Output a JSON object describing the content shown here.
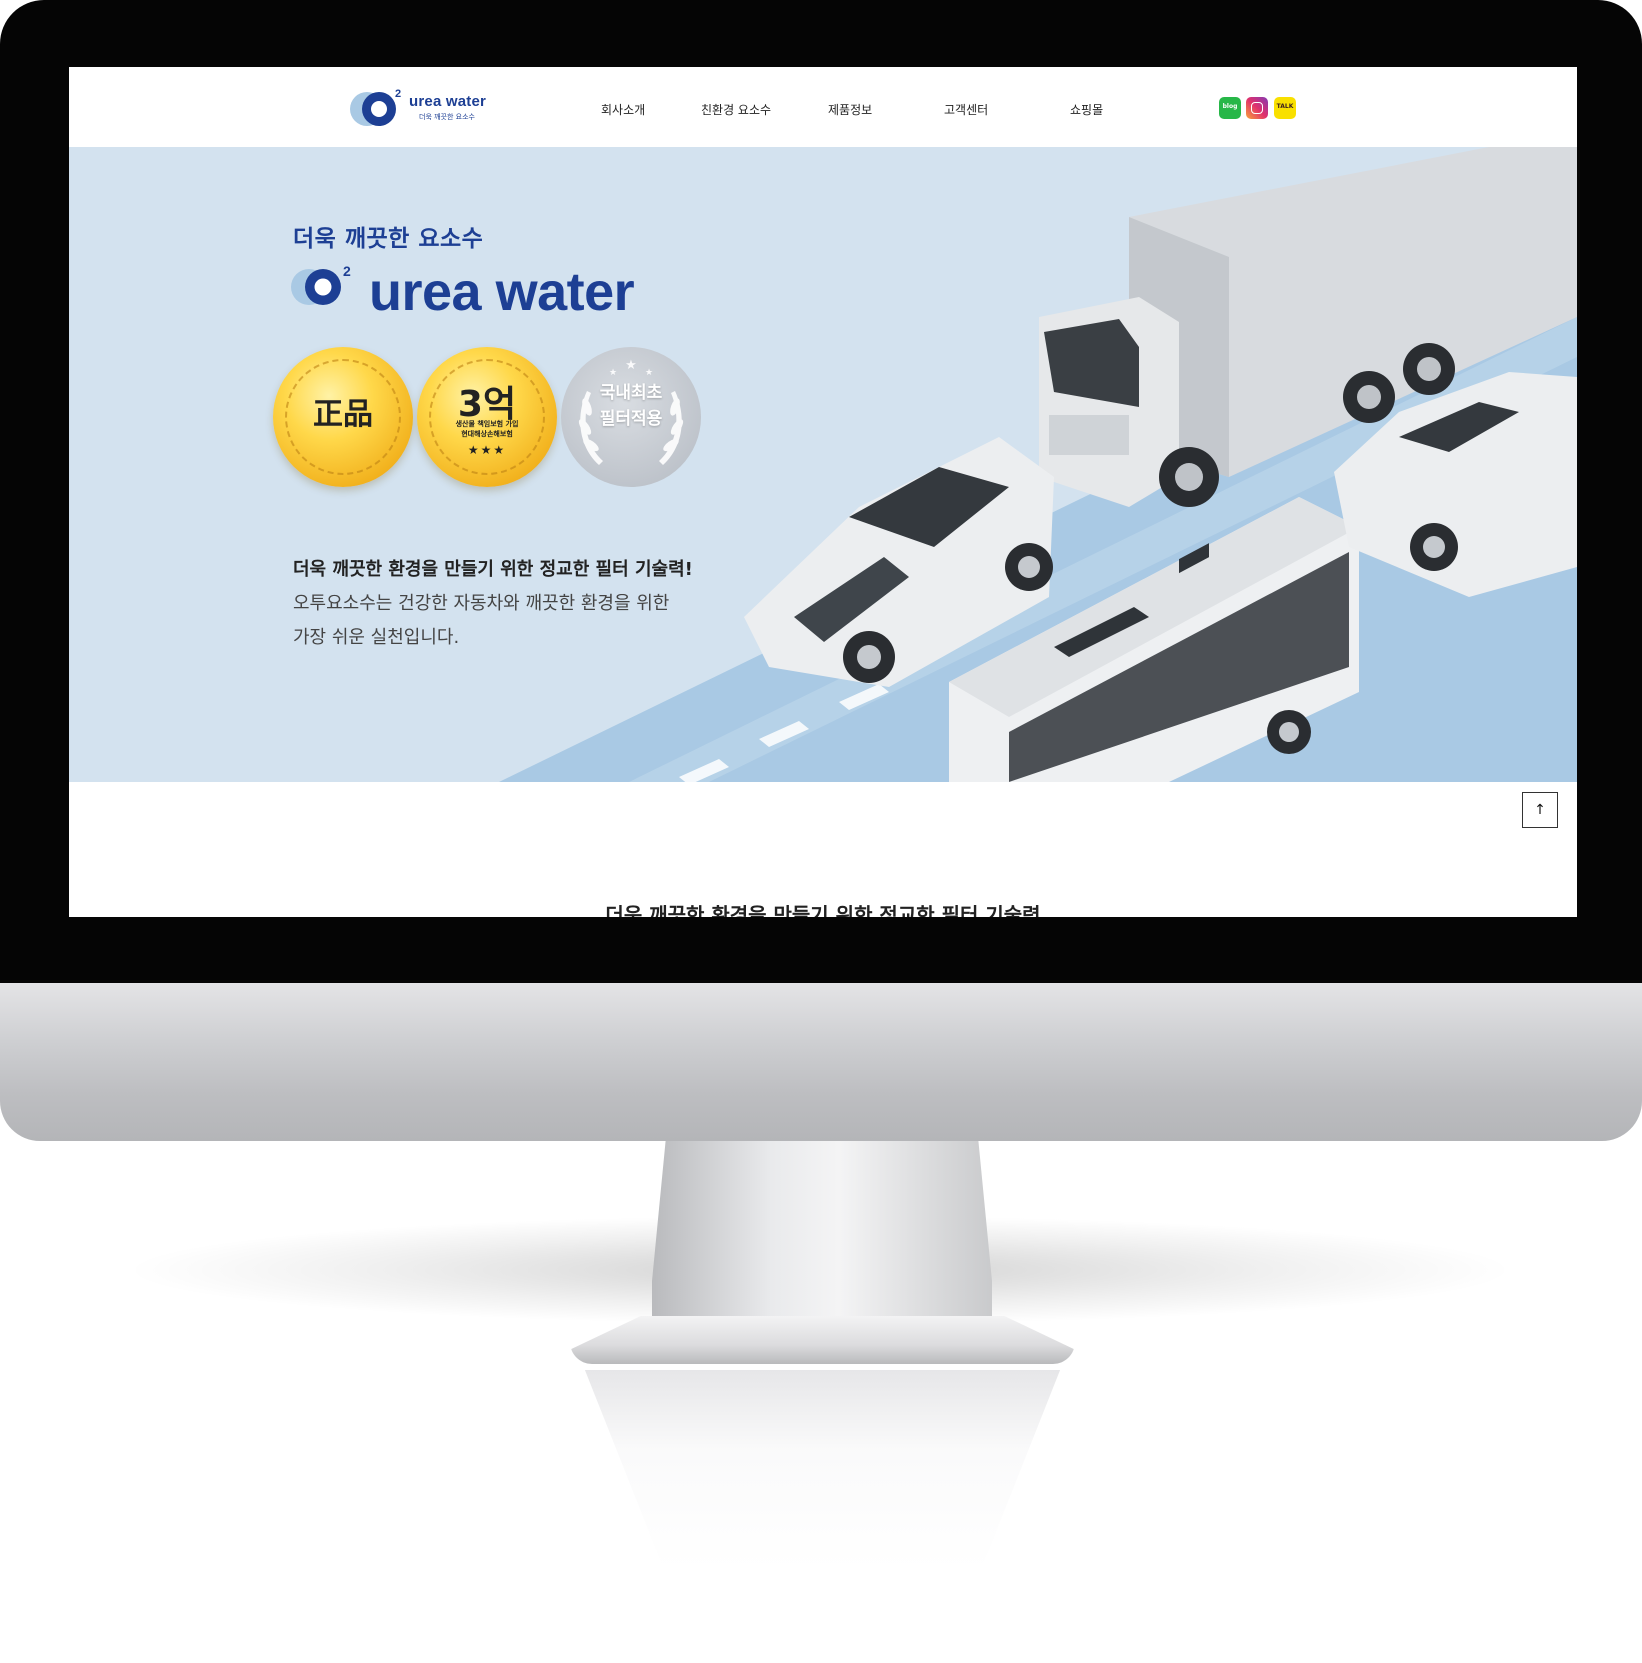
{
  "header": {
    "logo": {
      "main": "urea water",
      "sub": "더욱 깨끗한 요소수",
      "superscript": "2"
    },
    "nav": [
      {
        "label": "회사소개"
      },
      {
        "label": "친환경 요소수"
      },
      {
        "label": "제품정보"
      },
      {
        "label": "고객센터"
      },
      {
        "label": "쇼핑몰"
      }
    ],
    "social": {
      "blog": "blog",
      "talk": "TALK"
    }
  },
  "hero": {
    "tagline": "더욱 깨끗한 요소수",
    "brand": "urea water",
    "badges": {
      "genuine": "正品",
      "insurance_main": "3억",
      "insurance_sub1": "생산물 책임보험 가입",
      "insurance_sub2": "현대해상손해보험",
      "first_line1": "국내최초",
      "first_line2": "필터적용"
    },
    "headline": "더욱 깨끗한 환경을 만들기 위한 정교한 필터 기술력!",
    "desc_line1": "오투요소수는 건강한 자동차와 깨끗한 환경을 위한",
    "desc_line2": "가장 쉬운 실천입니다."
  },
  "scroll_top": {
    "icon": "↑"
  },
  "section": {
    "title": "더욱 깨끗한 환경을 만들기 위한 정교한 필터 기술력"
  },
  "colors": {
    "brand": "#1d3f94",
    "hero_bg": "#d3e2ef",
    "road": "#a9c9e4"
  }
}
